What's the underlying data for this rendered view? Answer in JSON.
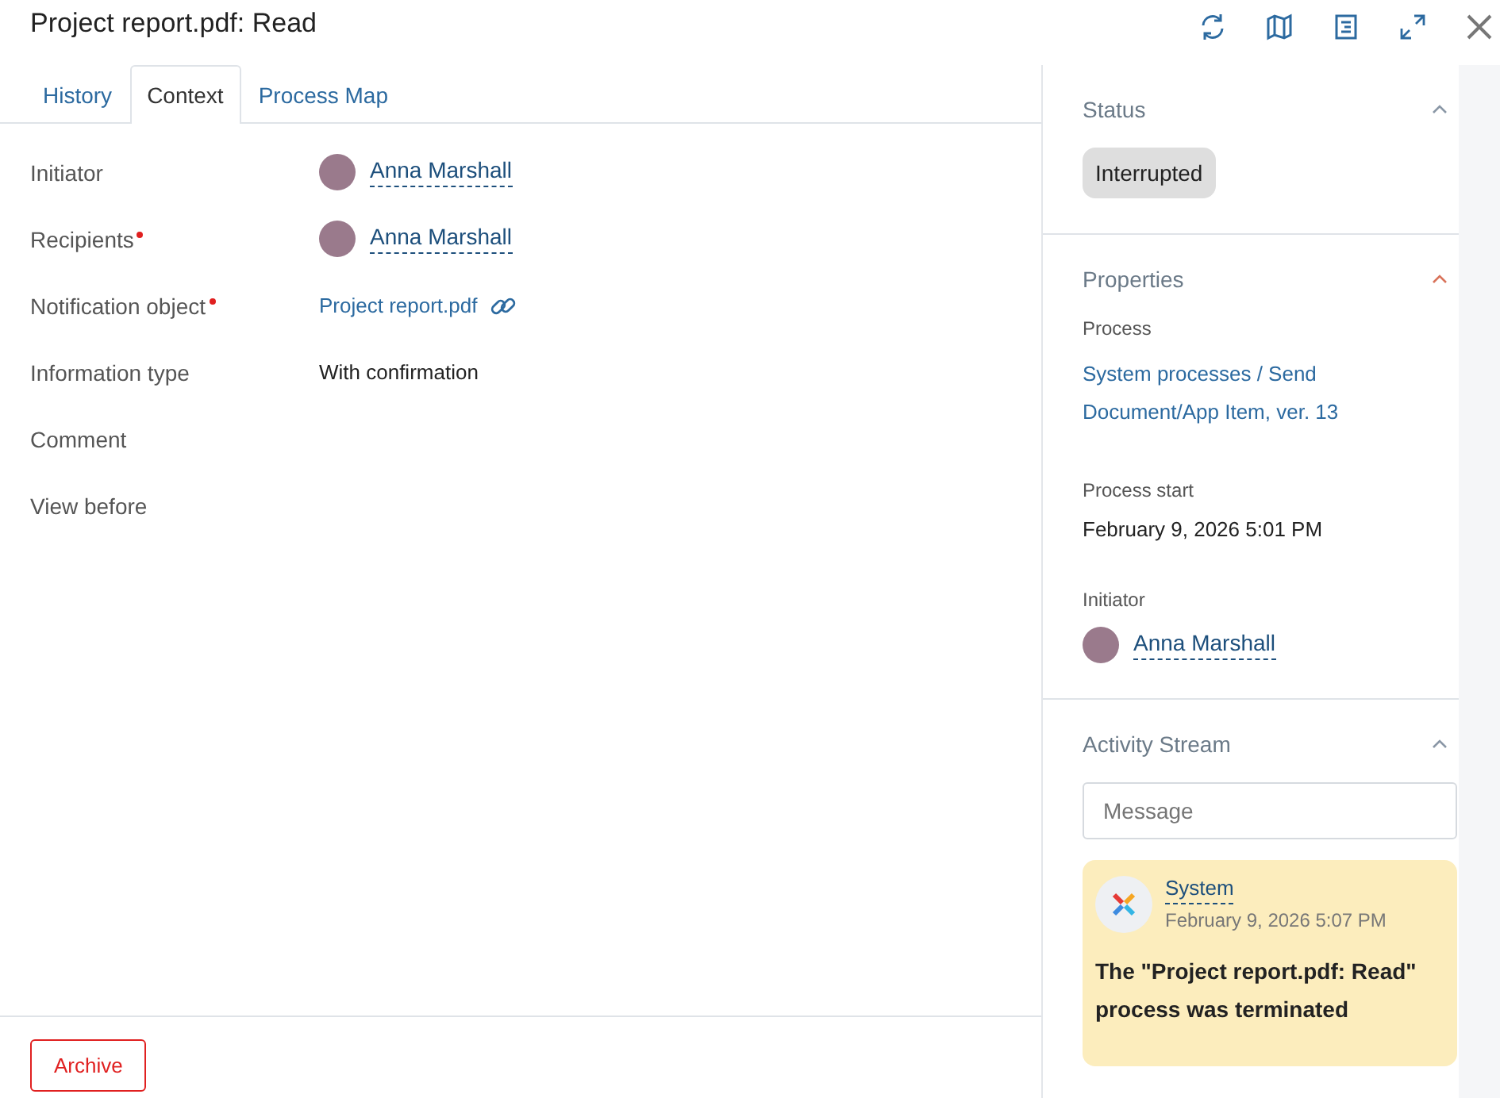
{
  "window": {
    "title": "Project report.pdf: Read"
  },
  "tabs": [
    {
      "label": "History",
      "selected": false
    },
    {
      "label": "Context",
      "selected": true
    },
    {
      "label": "Process Map",
      "selected": false
    }
  ],
  "fields": [
    {
      "label": "Initiator",
      "required": false,
      "kind": "person",
      "value": "Anna Marshall"
    },
    {
      "label": "Recipients",
      "required": true,
      "kind": "person",
      "value": "Anna Marshall"
    },
    {
      "label": "Notification object",
      "required": true,
      "kind": "file",
      "value": "Project report.pdf"
    },
    {
      "label": "Information type",
      "required": false,
      "kind": "text",
      "value": "With confirmation"
    },
    {
      "label": "Comment",
      "required": false,
      "kind": "empty"
    },
    {
      "label": "View before",
      "required": false,
      "kind": "empty"
    }
  ],
  "footer": {
    "button": "Archive"
  },
  "sidebar": {
    "status": {
      "title": "Status",
      "value": "Interrupted"
    },
    "properties": {
      "title": "Properties",
      "process_label": "Process",
      "process": "System processes / Send Document/App Item, ver. 13",
      "start_label": "Process start",
      "start": "February 9, 2026 5:01 PM",
      "initiator_label": "Initiator",
      "initiator": "Anna Marshall"
    },
    "activity": {
      "title": "Activity Stream",
      "placeholder": "Message",
      "entries": [
        {
          "author": "System",
          "time": "February 9, 2026 5:07 PM",
          "text": "The \"Project report.pdf: Read\" process was terminated"
        }
      ]
    }
  }
}
